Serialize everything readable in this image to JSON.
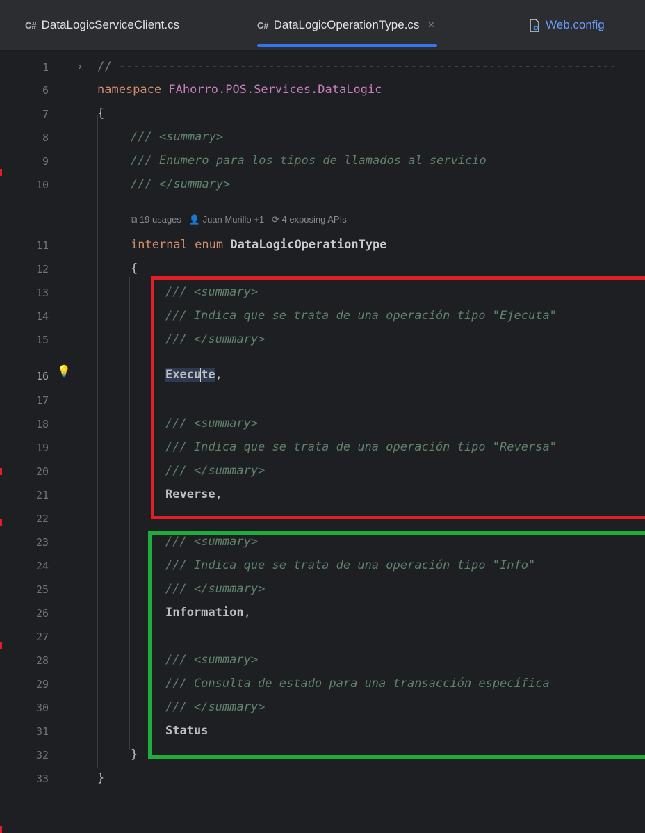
{
  "tabs": [
    {
      "icon": "csharp-file-icon",
      "prefix": "C#",
      "label": "DataLogicServiceClient.cs",
      "active": false
    },
    {
      "icon": "csharp-file-icon",
      "prefix": "C#",
      "label": "DataLogicOperationType.cs",
      "close": "×",
      "active": true
    },
    {
      "icon": "config-file-icon",
      "label": "Web.config",
      "active": false
    }
  ],
  "lines": {
    "l1": "1",
    "l6": "6",
    "l7": "7",
    "l8": "8",
    "l9": "9",
    "l10": "10",
    "l11": "11",
    "l12": "12",
    "l13": "13",
    "l14": "14",
    "l15": "15",
    "l16": "16",
    "l17": "17",
    "l18": "18",
    "l19": "19",
    "l20": "20",
    "l21": "21",
    "l22": "22",
    "l23": "23",
    "l24": "24",
    "l25": "25",
    "l26": "26",
    "l27": "27",
    "l28": "28",
    "l29": "29",
    "l30": "30",
    "l31": "31",
    "l32": "32",
    "l33": "33"
  },
  "code": {
    "fold_comment": "// ----------------------------------------------------------------------",
    "ns_keyword": "namespace",
    "ns_name": "FAhorro.POS.Services.DataLogic",
    "open_brace": "{",
    "close_brace": "}",
    "doc_prefix": "///",
    "summary_open": "<summary>",
    "summary_close": "</summary>",
    "enum_doc": "/// Enumero para los tipos de llamados al servicio",
    "hint_usages": "19 usages",
    "hint_author": "Juan Murillo +1",
    "hint_apis": "4 exposing APIs",
    "internal_kw": "internal",
    "enum_kw": "enum",
    "enum_name": "DataLogicOperationType",
    "doc_execute": "/// Indica que se trata de una operación tipo \"Ejecuta\"",
    "execute_a": "Execu",
    "execute_b": "te",
    "doc_reverse": "/// Indica que se trata de una operación tipo \"Reversa\"",
    "reverse": "Reverse",
    "doc_info": "/// Indica que se trata de una operación tipo \"Info\"",
    "information": "Information",
    "doc_status": "/// Consulta de estado para una transacción específica",
    "status": "Status",
    "comma": ","
  },
  "colors": {
    "red_highlight": "#e01f26",
    "green_highlight": "#1fad3d",
    "accent_tab": "#3574f0"
  }
}
